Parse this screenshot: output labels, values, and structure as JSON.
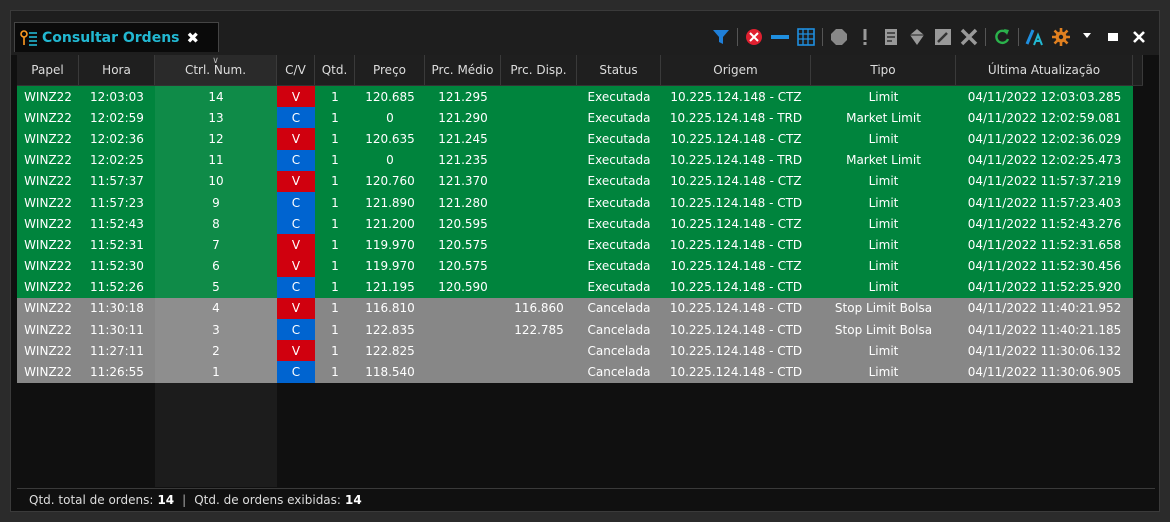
{
  "tab": {
    "title": "Consultar Ordens",
    "close": "✖"
  },
  "toolbar": {
    "icons": [
      "filter-icon",
      "cancel-order-icon",
      "minus-icon",
      "grid-icon",
      "stop-icon",
      "alert-icon",
      "report-icon",
      "diamond-icon",
      "edit-icon",
      "delete-icon",
      "refresh-icon",
      "font-icon",
      "settings-icon",
      "dropdown-icon",
      "maximize-icon",
      "close-icon"
    ],
    "colors": {
      "filter": "#1f7fd8",
      "cancel": "#e02030",
      "accent": "#22b8d2",
      "green": "#2bb24c",
      "orange": "#e08020"
    }
  },
  "columns": [
    "Papel",
    "Hora",
    "Ctrl. Num.",
    "C/V",
    "Qtd.",
    "Preço",
    "Prc. Médio",
    "Prc. Disp.",
    "Status",
    "Origem",
    "Tipo",
    "Última Atualização"
  ],
  "rows": [
    [
      "WINZ22",
      "12:03:03",
      "14",
      "V",
      "1",
      "120.685",
      "121.295",
      "",
      "Executada",
      "10.225.124.148 - CTZ",
      "Limit",
      "04/11/2022 12:03:03.285"
    ],
    [
      "WINZ22",
      "12:02:59",
      "13",
      "C",
      "1",
      "0",
      "121.290",
      "",
      "Executada",
      "10.225.124.148 - TRD",
      "Market Limit",
      "04/11/2022 12:02:59.081"
    ],
    [
      "WINZ22",
      "12:02:36",
      "12",
      "V",
      "1",
      "120.635",
      "121.245",
      "",
      "Executada",
      "10.225.124.148 - CTZ",
      "Limit",
      "04/11/2022 12:02:36.029"
    ],
    [
      "WINZ22",
      "12:02:25",
      "11",
      "C",
      "1",
      "0",
      "121.235",
      "",
      "Executada",
      "10.225.124.148 - TRD",
      "Market Limit",
      "04/11/2022 12:02:25.473"
    ],
    [
      "WINZ22",
      "11:57:37",
      "10",
      "V",
      "1",
      "120.760",
      "121.370",
      "",
      "Executada",
      "10.225.124.148 - CTZ",
      "Limit",
      "04/11/2022 11:57:37.219"
    ],
    [
      "WINZ22",
      "11:57:23",
      "9",
      "C",
      "1",
      "121.890",
      "121.280",
      "",
      "Executada",
      "10.225.124.148 - CTD",
      "Limit",
      "04/11/2022 11:57:23.403"
    ],
    [
      "WINZ22",
      "11:52:43",
      "8",
      "C",
      "1",
      "121.200",
      "120.595",
      "",
      "Executada",
      "10.225.124.148 - CTZ",
      "Limit",
      "04/11/2022 11:52:43.276"
    ],
    [
      "WINZ22",
      "11:52:31",
      "7",
      "V",
      "1",
      "119.970",
      "120.575",
      "",
      "Executada",
      "10.225.124.148 - CTD",
      "Limit",
      "04/11/2022 11:52:31.658"
    ],
    [
      "WINZ22",
      "11:52:30",
      "6",
      "V",
      "1",
      "119.970",
      "120.575",
      "",
      "Executada",
      "10.225.124.148 - CTZ",
      "Limit",
      "04/11/2022 11:52:30.456"
    ],
    [
      "WINZ22",
      "11:52:26",
      "5",
      "C",
      "1",
      "121.195",
      "120.590",
      "",
      "Executada",
      "10.225.124.148 - CTD",
      "Limit",
      "04/11/2022 11:52:25.920"
    ],
    [
      "WINZ22",
      "11:30:18",
      "4",
      "V",
      "1",
      "116.810",
      "",
      "116.860",
      "Cancelada",
      "10.225.124.148 - CTD",
      "Stop Limit Bolsa",
      "04/11/2022 11:40:21.952"
    ],
    [
      "WINZ22",
      "11:30:11",
      "3",
      "C",
      "1",
      "122.835",
      "",
      "122.785",
      "Cancelada",
      "10.225.124.148 - CTD",
      "Stop Limit Bolsa",
      "04/11/2022 11:40:21.185"
    ],
    [
      "WINZ22",
      "11:27:11",
      "2",
      "V",
      "1",
      "122.825",
      "",
      "",
      "Cancelada",
      "10.225.124.148 - CTD",
      "Limit",
      "04/11/2022 11:30:06.132"
    ],
    [
      "WINZ22",
      "11:26:55",
      "1",
      "C",
      "1",
      "118.540",
      "",
      "",
      "Cancelada",
      "10.225.124.148 - CTD",
      "Limit",
      "04/11/2022 11:30:06.905"
    ]
  ],
  "status_colors": {
    "Executada": "#00843d",
    "Cancelada": "#878787"
  },
  "cv_colors": {
    "V": "#d0000e",
    "C": "#0064d0"
  },
  "footer": {
    "total_label": "Qtd. total de ordens:",
    "total_value": "14",
    "separator": "|",
    "shown_label": "Qtd. de ordens exibidas:",
    "shown_value": "14"
  }
}
